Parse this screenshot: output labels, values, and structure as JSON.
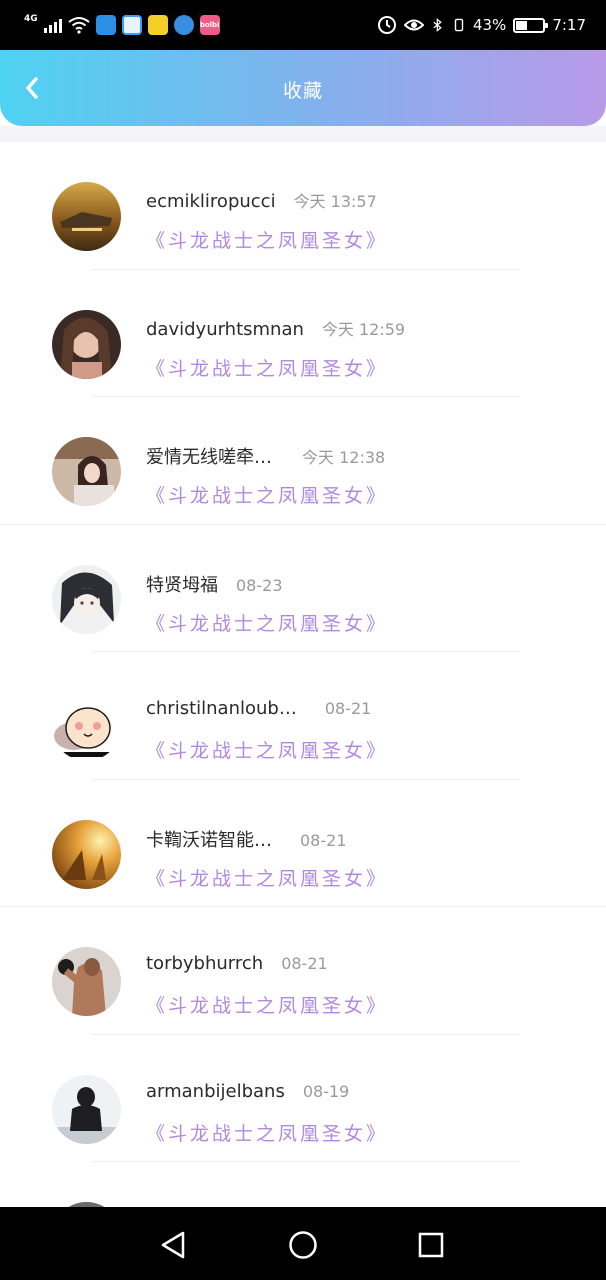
{
  "status_bar": {
    "network": "4G",
    "battery_percent": "43%",
    "battery_level": 0.43,
    "time": "7:17",
    "app_icon_labels": [
      "",
      "",
      "",
      "",
      "bolbi"
    ]
  },
  "header": {
    "title": "收藏",
    "back_icon": "chevron-left-icon",
    "gradient": [
      "#4fd2f2",
      "#b99ae9"
    ]
  },
  "colors": {
    "work_title": "#b18ae0",
    "time": "#9a9a9a"
  },
  "favorites": [
    {
      "name": "ecmikliropucci",
      "time": "今天 13:57",
      "work": "《斗龙战士之凤凰圣女》"
    },
    {
      "name": "davidyurhtsmnan",
      "time": "今天 12:59",
      "work": "《斗龙战士之凤凰圣女》"
    },
    {
      "name": "爱情无线嗟牵…",
      "time": "今天 12:38",
      "work": "《斗龙战士之凤凰圣女》"
    },
    {
      "name": "特贤坶福",
      "time": "08-23",
      "work": "《斗龙战士之凤凰圣女》"
    },
    {
      "name": "christilnanloub…",
      "time": "08-21",
      "work": "《斗龙战士之凤凰圣女》"
    },
    {
      "name": "卡鞫沃诺智能…",
      "time": "08-21",
      "work": "《斗龙战士之凤凰圣女》"
    },
    {
      "name": "torbybhurrch",
      "time": "08-21",
      "work": "《斗龙战士之凤凰圣女》"
    },
    {
      "name": "armanbijelbans",
      "time": "08-19",
      "work": "《斗龙战士之凤凰圣女》"
    }
  ],
  "nav_bar": {
    "icons": [
      "back-triangle-icon",
      "home-circle-icon",
      "recents-square-icon"
    ]
  }
}
